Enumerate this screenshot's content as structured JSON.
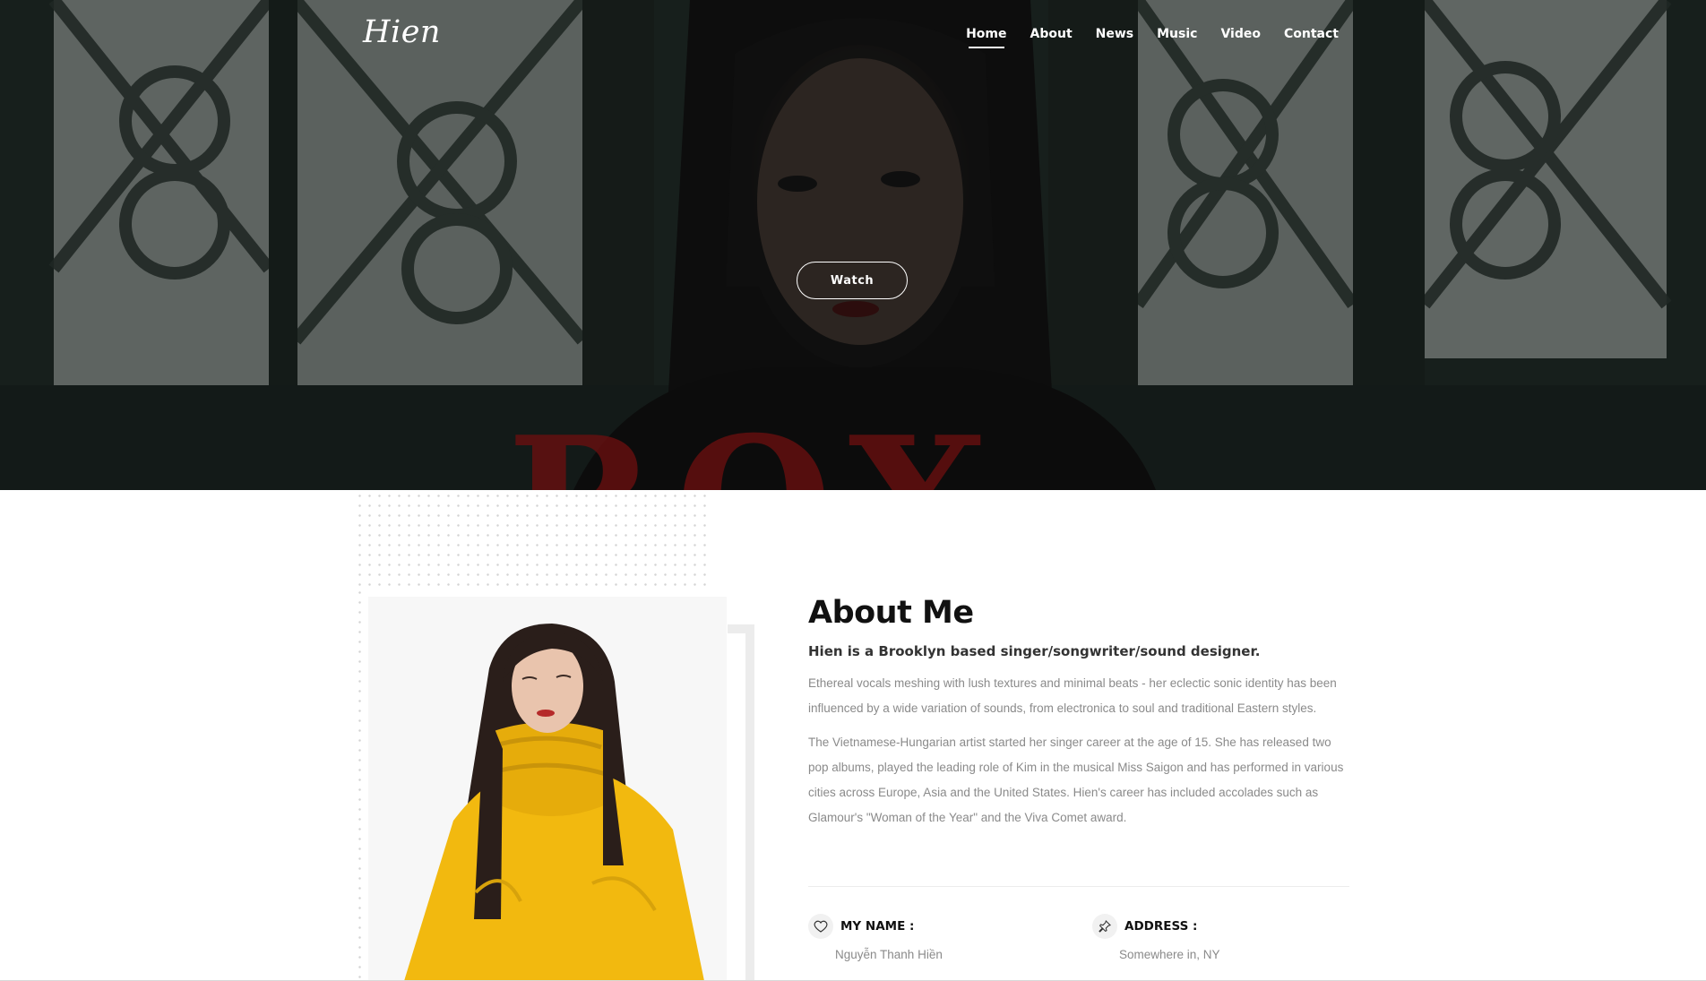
{
  "site": {
    "logo": "Hien"
  },
  "nav": {
    "items": [
      {
        "label": "Home",
        "active": true
      },
      {
        "label": "About",
        "active": false
      },
      {
        "label": "News",
        "active": false
      },
      {
        "label": "Music",
        "active": false
      },
      {
        "label": "Video",
        "active": false
      },
      {
        "label": "Contact",
        "active": false
      }
    ]
  },
  "hero": {
    "watch_label": "Watch",
    "big_text": "ROX",
    "big_text_color": "#6e0f0f"
  },
  "about": {
    "title": "About Me",
    "subtitle": "Hien is a Brooklyn based singer/songwriter/sound designer.",
    "paragraphs": [
      "Ethereal vocals meshing with lush textures and minimal beats - her eclectic sonic identity has been influenced by a wide variation of sounds, from electronica to soul and traditional Eastern styles.",
      "The Vietnamese-Hungarian artist started her singer career at the age of 15. She has released two pop albums, played the leading role of Kim in the musical Miss Saigon and has performed in various cities across Europe, Asia and the United States. Hien's career has included accolades such as Glamour's \"Woman of the Year\" and the Viva Comet award."
    ],
    "info": {
      "name_label": "MY NAME :",
      "name_value": "Nguyễn Thanh Hiền",
      "name_icon": "heart-icon",
      "address_label": "ADDRESS :",
      "address_value": "Somewhere in, NY",
      "address_icon": "pin-icon"
    }
  },
  "colors": {
    "sweater": "#f2b90f",
    "hero_dark": "#1f2a26"
  }
}
